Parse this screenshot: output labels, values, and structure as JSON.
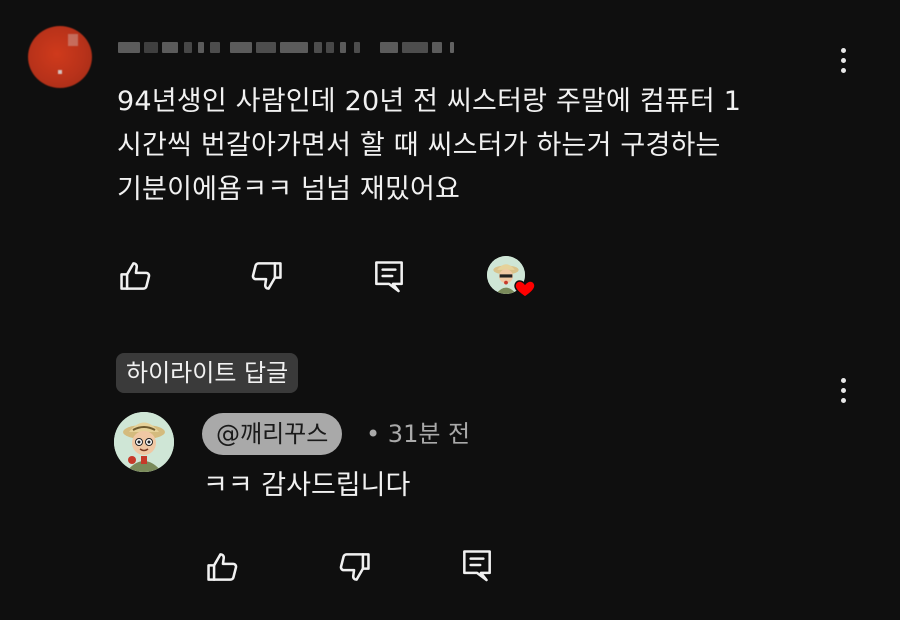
{
  "comment": {
    "text": "94년생인 사람인데 20년 전 씨스터랑 주말에 컴퓨터 1\n시간씩 번갈아가면서 할 때 씨스터가 하는거 구경하는\n기분이에욤ㅋㅋ 넘넘 재밌어요",
    "author_blurred": true,
    "actions": [
      "like-icon",
      "dislike-icon",
      "reply-icon",
      "creator-heart-icon"
    ]
  },
  "highlight": {
    "label": "하이라이트 답글"
  },
  "reply": {
    "handle": "@깨리꾸스",
    "separator": "•",
    "time": "31분 전",
    "text": "ㅋㅋ 감사드립니다",
    "actions": [
      "like-icon",
      "dislike-icon",
      "reply-icon"
    ]
  },
  "colors": {
    "background": "#0f0f0f",
    "text": "#f1f1f1",
    "muted": "#aaaaaa",
    "chip": "#3a3a3a",
    "handle_chip": "#a9a9a9",
    "heart": "#ff0000",
    "avatar_red": "#c0361b"
  }
}
